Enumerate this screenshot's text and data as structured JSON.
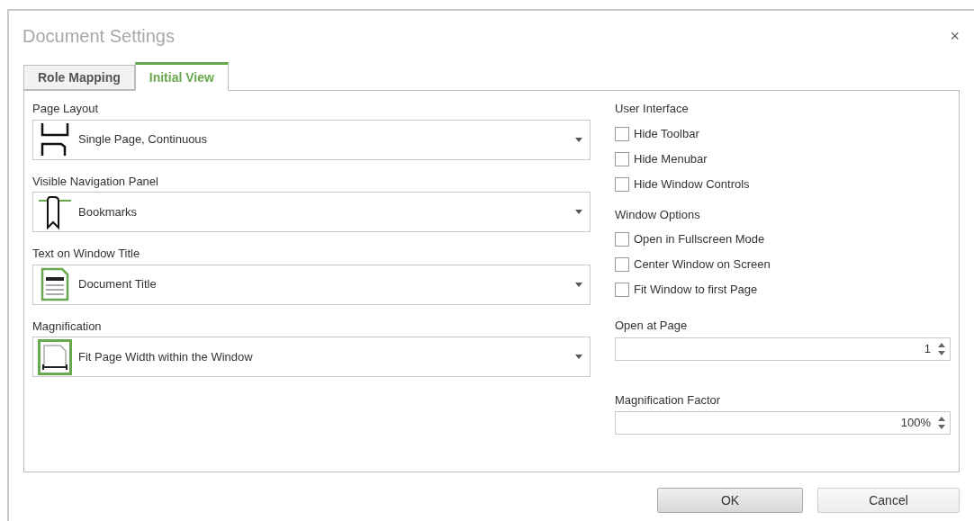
{
  "window": {
    "title": "Document Settings",
    "close": "×"
  },
  "tabs": [
    {
      "label": "Role Mapping",
      "selected": false
    },
    {
      "label": "Initial View",
      "selected": true
    }
  ],
  "dropdowns": [
    {
      "label": "Page Layout",
      "value": "Single Page, Continuous",
      "kind": "page_layout"
    },
    {
      "label": "Visible Navigation Panel",
      "value": "Bookmarks",
      "kind": "bookmark"
    },
    {
      "label": "Text on Window Title",
      "value": "Document Title",
      "kind": "document_title"
    },
    {
      "label": "Magnification",
      "value": "Fit Page Width within the Window",
      "kind": "fit_width"
    }
  ],
  "groups": [
    {
      "title": "User Interface",
      "options": [
        {
          "label": "Hide Toolbar",
          "checked": false
        },
        {
          "label": "Hide Menubar",
          "checked": false
        },
        {
          "label": "Hide Window Controls",
          "checked": false
        }
      ]
    },
    {
      "title": "Window Options",
      "options": [
        {
          "label": "Open in Fullscreen Mode",
          "checked": false
        },
        {
          "label": "Center Window on Screen",
          "checked": false
        },
        {
          "label": "Fit Window to first Page",
          "checked": false
        }
      ]
    }
  ],
  "spinners": [
    {
      "label": "Open at Page",
      "value": "1"
    },
    {
      "label": "Magnification Factor",
      "value": "100%"
    }
  ],
  "buttons": [
    {
      "label": "OK"
    },
    {
      "label": "Cancel"
    }
  ]
}
